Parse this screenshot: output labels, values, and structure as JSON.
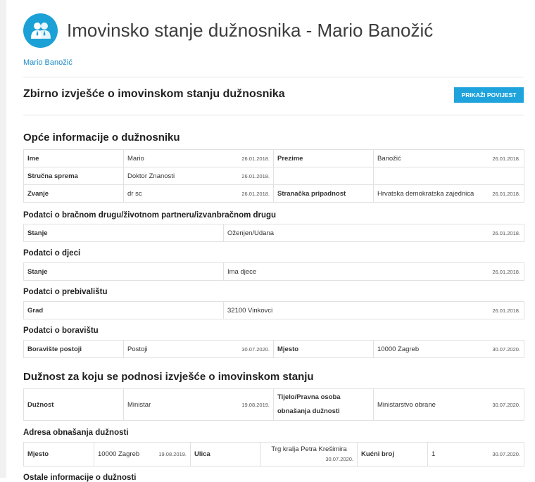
{
  "page": {
    "title": "Imovinsko stanje dužnosnika - Mario Banožić",
    "breadcrumb": "Mario Banožić",
    "report_title": "Zbirno izvješće o imovinskom stanju dužnosnika",
    "history_button": "PRIKAŽI POVIJEST",
    "accent_color": "#1fa3dc"
  },
  "general": {
    "heading": "Opće informacije o dužnosniku",
    "ime": {
      "label": "Ime",
      "value": "Mario",
      "date": "26.01.2018."
    },
    "prezime": {
      "label": "Prezime",
      "value": "Banožić",
      "date": "26.01.2018."
    },
    "sprema": {
      "label": "Stručna sprema",
      "value": "Doktor Znanosti",
      "date": "26.01.2018."
    },
    "zvanje": {
      "label": "Zvanje",
      "value": "dr sc",
      "date": "26.01.2018."
    },
    "stranka": {
      "label": "Stranačka pripadnost",
      "value": "Hrvatska demokratska zajednica",
      "date": "26.01.2018."
    }
  },
  "partner": {
    "heading": "Podatci o bračnom drugu/životnom partneru/izvanbračnom drugu",
    "label": "Stanje",
    "value": "Oženjen/Udana",
    "date": "26.01.2018."
  },
  "children": {
    "heading": "Podatci o djeci",
    "label": "Stanje",
    "value": "Ima djece",
    "date": "26.01.2018."
  },
  "residence": {
    "heading": "Podatci o prebivalištu",
    "label": "Grad",
    "value": "32100 Vinkovci",
    "date": "26.01.2018."
  },
  "stay": {
    "heading": "Podatci o boravištu",
    "exists": {
      "label": "Boravište postoji",
      "value": "Postoji",
      "date": "30.07.2020."
    },
    "place": {
      "label": "Mjesto",
      "value": "10000 Zagreb",
      "date": "30.07.2020."
    }
  },
  "duty": {
    "heading": "Dužnost za koju se podnosi izvješće o imovinskom stanju",
    "duznost": {
      "label": "Dužnost",
      "value": "Ministar",
      "date": "19.08.2019."
    },
    "tijelo": {
      "label": "Tijelo/Pravna osoba obnašanja dužnosti",
      "value": "Ministarstvo obrane",
      "date": "30.07.2020."
    }
  },
  "address": {
    "heading": "Adresa obnašanja dužnosti",
    "mjesto": {
      "label": "Mjesto",
      "value": "10000 Zagreb",
      "date": "19.08.2019."
    },
    "ulica": {
      "label": "Ulica",
      "value": "Trg kralja Petra Krešimira",
      "date": "30.07.2020."
    },
    "broj": {
      "label": "Kućni broj",
      "value": "1",
      "date": "30.07.2020."
    }
  },
  "next_heading": "Ostale informacije o dužnosti"
}
